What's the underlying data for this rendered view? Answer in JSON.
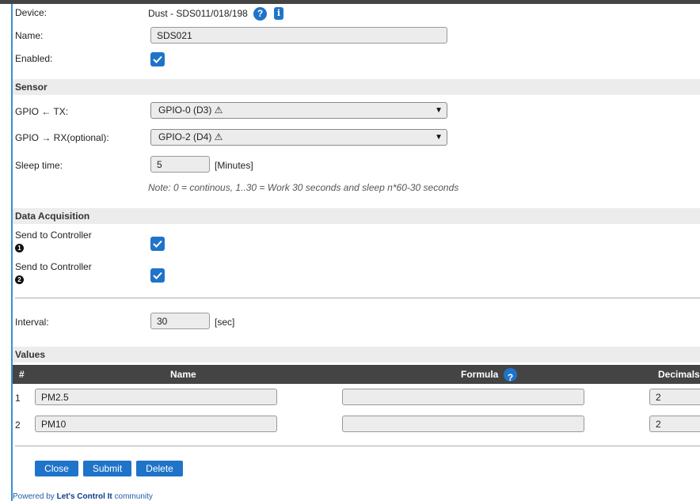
{
  "device": {
    "label": "Device:",
    "value": "Dust - SDS011/018/198"
  },
  "name": {
    "label": "Name:",
    "value": "SDS021"
  },
  "enabled": {
    "label": "Enabled:",
    "checked": true
  },
  "sensor_section": "Sensor",
  "gpio_tx": {
    "label": "GPIO ← TX:",
    "selected": "GPIO-0 (D3) ⚠"
  },
  "gpio_rx": {
    "label": "GPIO → RX(optional):",
    "selected": "GPIO-2 (D4) ⚠"
  },
  "sleep": {
    "label": "Sleep time:",
    "value": "5",
    "unit": "[Minutes]"
  },
  "note": "Note: 0 = continous, 1..30 = Work 30 seconds and sleep n*60-30 seconds",
  "data_section": "Data Acquisition",
  "controller1": {
    "label": "Send to Controller",
    "index": "1",
    "checked": true
  },
  "controller2": {
    "label": "Send to Controller",
    "index": "2",
    "checked": true
  },
  "interval": {
    "label": "Interval:",
    "value": "30",
    "unit": "[sec]"
  },
  "values_section": "Values",
  "table": {
    "headers": [
      "#",
      "Name",
      "Formula",
      "Decimals"
    ],
    "rows": [
      {
        "num": "1",
        "name": "PM2.5",
        "formula": "",
        "decimals": "2"
      },
      {
        "num": "2",
        "name": "PM10",
        "formula": "",
        "decimals": "2"
      }
    ]
  },
  "buttons": {
    "close": "Close",
    "submit": "Submit",
    "delete": "Delete"
  },
  "footer": {
    "prefix": "Powered by",
    "brand": "Let's Control It",
    "suffix": "community"
  },
  "icons": {
    "help": "question-icon",
    "info": "info-icon",
    "check": "check-icon"
  },
  "colors": {
    "accent": "#1f74c9",
    "header_dark": "#444444",
    "section_bg": "#ececec"
  }
}
